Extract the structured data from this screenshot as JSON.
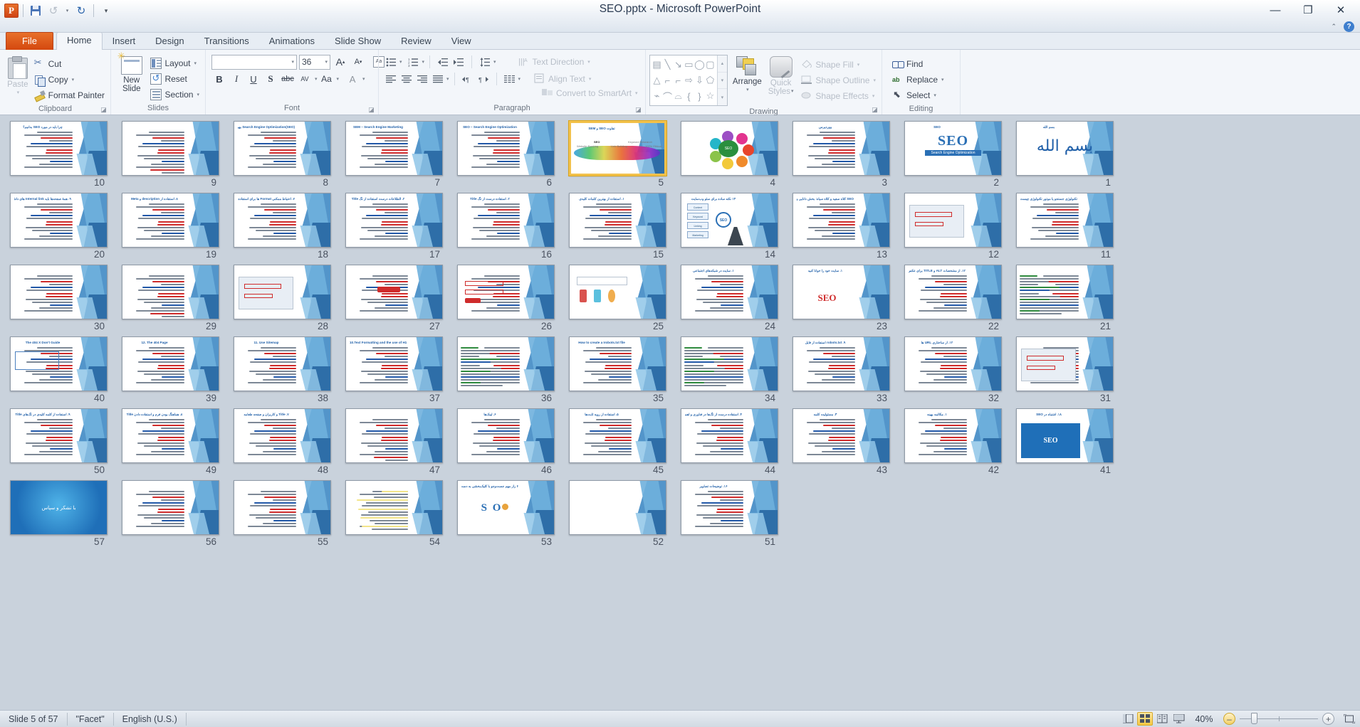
{
  "window": {
    "title": "SEO.pptx  -  Microsoft PowerPoint",
    "minimize": "—",
    "restore": "❐",
    "close": "✕",
    "ribbon_collapse": "⌃",
    "help": "?"
  },
  "qat": {
    "app_letter": "P",
    "save": "save-icon",
    "undo": "↺",
    "undo_caret": "▾",
    "redo": "↻",
    "customize": "▾"
  },
  "tabs": [
    {
      "label": "File",
      "type": "file"
    },
    {
      "label": "Home",
      "type": "active"
    },
    {
      "label": "Insert",
      "type": "normal"
    },
    {
      "label": "Design",
      "type": "normal"
    },
    {
      "label": "Transitions",
      "type": "normal"
    },
    {
      "label": "Animations",
      "type": "normal"
    },
    {
      "label": "Slide Show",
      "type": "normal"
    },
    {
      "label": "Review",
      "type": "normal"
    },
    {
      "label": "View",
      "type": "normal"
    }
  ],
  "ribbon": {
    "groups": [
      {
        "name": "Clipboard",
        "label": "Clipboard",
        "launcher": true
      },
      {
        "name": "Slides",
        "label": "Slides",
        "launcher": false
      },
      {
        "name": "Font",
        "label": "Font",
        "launcher": true
      },
      {
        "name": "Paragraph",
        "label": "Paragraph",
        "launcher": true
      },
      {
        "name": "Drawing",
        "label": "Drawing",
        "launcher": true
      },
      {
        "name": "Editing",
        "label": "Editing",
        "launcher": false
      }
    ],
    "clipboard": {
      "paste": "Paste",
      "paste_caret": "▾",
      "cut": "Cut",
      "copy": "Copy",
      "copy_caret": "▾",
      "format_painter": "Format Painter"
    },
    "slides": {
      "new_slide_line1": "New",
      "new_slide_line2": "Slide",
      "new_slide_caret": "▾",
      "layout": "Layout",
      "layout_caret": "▾",
      "reset": "Reset",
      "section": "Section",
      "section_caret": "▾"
    },
    "font": {
      "font_name": "",
      "font_name_caret": "▾",
      "font_size": "36",
      "font_size_caret": "▾",
      "grow_font": "A",
      "shrink_font": "A",
      "clear_formatting": "Aa",
      "bold": "B",
      "italic": "I",
      "underline": "U",
      "shadow": "S",
      "strikethrough": "abc",
      "char_spacing": "AV",
      "change_case": "Aa",
      "font_color": "A"
    },
    "paragraph": {
      "bullets": "bullets-icon",
      "numbering": "numbering-icon",
      "decrease_indent": "decrease-indent-icon",
      "increase_indent": "increase-indent-icon",
      "line_spacing": "line-spacing-icon",
      "align_left": "align-left-icon",
      "align_center": "align-center-icon",
      "align_right": "align-right-icon",
      "justify": "justify-icon",
      "ltr": "ltr-icon",
      "rtl": "rtl-icon",
      "columns": "columns-icon",
      "text_direction": "Text Direction",
      "align_text": "Align Text",
      "convert_to_smartart": "Convert to SmartArt"
    },
    "drawing": {
      "shapes": [
        "text-box",
        "line",
        "arrow",
        "rectangle",
        "oval",
        "rounded-rectangle",
        "triangle",
        "elbow-connector",
        "elbow-arrow-connector",
        "right-arrow",
        "down-arrow",
        "pentagon",
        "freeform",
        "curve",
        "arc",
        "left-brace",
        "right-brace",
        "star"
      ],
      "scroll_up": "▴",
      "scroll_down": "▾",
      "more": "▾",
      "arrange": "Arrange",
      "arrange_caret": "▾",
      "quick_styles_l1": "Quick",
      "quick_styles_l2": "Styles",
      "quick_styles_caret": "▾",
      "shape_fill": "Shape Fill",
      "shape_outline": "Shape Outline",
      "shape_effects": "Shape Effects",
      "caret": "▾"
    },
    "editing": {
      "find": "Find",
      "replace": "Replace",
      "select": "Select",
      "caret": "▾"
    }
  },
  "status": {
    "slide_counter": "Slide 5 of 57",
    "theme": "\"Facet\"",
    "language": "English (U.S.)",
    "zoom_level": "40%",
    "zoom_out": "–",
    "zoom_in": "+",
    "views": [
      {
        "name": "normal-view",
        "glyph": "normal"
      },
      {
        "name": "slide-sorter-view",
        "glyph": "sorter",
        "active": true
      },
      {
        "name": "reading-view",
        "glyph": "reading"
      },
      {
        "name": "slide-show-view",
        "glyph": "show"
      }
    ],
    "fit_to_window": "fit-slide-to-window-icon"
  },
  "sorter": {
    "selected_slide": 5,
    "rows": [
      [
        {
          "n": 10,
          "title": "چرا باید در مورد SEO بدانیم؟",
          "rtl": true,
          "kind": "text",
          "lines": "t"
        },
        {
          "n": 9,
          "title": "",
          "rtl": true,
          "kind": "text",
          "lines": "dense"
        },
        {
          "n": 8,
          "title": "Search Engine Optimization(SEO) بهینه سازی موتور جستجو",
          "rtl": true,
          "kind": "text",
          "lines": "t"
        },
        {
          "n": 7,
          "title": "SEM – Search Engine Marketing",
          "rtl": false,
          "kind": "text",
          "lines": "t"
        },
        {
          "n": 6,
          "title": "SEO – Search Engine Optimization",
          "rtl": false,
          "kind": "text",
          "lines": "t"
        },
        {
          "n": 5,
          "title": "تفاوت SEO و SEM",
          "rtl": true,
          "kind": "wave",
          "lines": "none"
        },
        {
          "n": 4,
          "title": "",
          "rtl": true,
          "kind": "seo-process",
          "lines": "none"
        },
        {
          "n": 3,
          "title": "ووردپرس",
          "rtl": true,
          "kind": "text",
          "lines": "t"
        },
        {
          "n": 2,
          "title": "SEO",
          "rtl": false,
          "kind": "seo-big",
          "lines": "none"
        },
        {
          "n": 1,
          "title": "بسم الله",
          "rtl": true,
          "kind": "bismillah",
          "lines": "none"
        }
      ],
      [
        {
          "n": 20,
          "title": "۹. همهٔ صفحه‌ها باید Internal link های داشته باشند",
          "rtl": true,
          "kind": "text",
          "lines": "t"
        },
        {
          "n": 19,
          "title": "۸. استفاده از description و Meta",
          "rtl": true,
          "kind": "text",
          "lines": "t"
        },
        {
          "n": 18,
          "title": "۷. احتیاط ممکنی Format ها برای استفاده از تگ Title های",
          "rtl": true,
          "kind": "text",
          "lines": "t"
        },
        {
          "n": 17,
          "title": "۲. الطلاعات درست استفاده از تگ Title",
          "rtl": true,
          "kind": "text",
          "lines": "t"
        },
        {
          "n": 16,
          "title": "۲. استفاده درست از تگ Title",
          "rtl": true,
          "kind": "text",
          "lines": "t"
        },
        {
          "n": 15,
          "title": "۱. استفاده از بهترین کلمات کلیدی",
          "rtl": true,
          "kind": "text",
          "lines": "t"
        },
        {
          "n": 14,
          "title": "۱۴ نکته ساده برای سئو وب‌سایت",
          "rtl": true,
          "kind": "smartart",
          "lines": "none"
        },
        {
          "n": 13,
          "title": "SEO کلاه سفید و کلاه سیاه: بخش دانایی و بخش فانی فنی",
          "rtl": true,
          "kind": "text",
          "lines": "t"
        },
        {
          "n": 12,
          "title": "",
          "rtl": true,
          "kind": "screenshot",
          "lines": "none"
        },
        {
          "n": 11,
          "title": "تکنولوژی جستجو یا موتور تکنولوژی چیست",
          "rtl": true,
          "kind": "text",
          "lines": "t"
        }
      ],
      [
        {
          "n": 30,
          "title": "",
          "rtl": true,
          "kind": "text",
          "lines": "t"
        },
        {
          "n": 29,
          "title": "",
          "rtl": true,
          "kind": "text",
          "lines": "dense"
        },
        {
          "n": 28,
          "title": "",
          "rtl": true,
          "kind": "screenshot",
          "lines": "none"
        },
        {
          "n": 27,
          "title": "",
          "rtl": true,
          "kind": "redbtn",
          "lines": "t"
        },
        {
          "n": 26,
          "title": "",
          "rtl": true,
          "kind": "form",
          "lines": "t"
        },
        {
          "n": 25,
          "title": "",
          "rtl": true,
          "kind": "diagram",
          "lines": "none"
        },
        {
          "n": 24,
          "title": "۱. سایت در شبکه‌های اجتماعی",
          "rtl": true,
          "kind": "text",
          "lines": "t"
        },
        {
          "n": 23,
          "title": "۱. سایت خود را خوانا کنید",
          "rtl": true,
          "kind": "seo-logo",
          "lines": "none"
        },
        {
          "n": 22,
          "title": "۱۲. از مشخصات ALT و TITLE برای عکس‌های img استفاده",
          "rtl": true,
          "kind": "text",
          "lines": "t"
        },
        {
          "n": 21,
          "title": "",
          "rtl": false,
          "kind": "code",
          "lines": "t"
        }
      ],
      [
        {
          "n": 40,
          "title": "The 404 X Don't Guide",
          "rtl": false,
          "kind": "doc",
          "lines": "t"
        },
        {
          "n": 39,
          "title": "12. The 404 Page",
          "rtl": false,
          "kind": "text",
          "lines": "t"
        },
        {
          "n": 38,
          "title": "11. Use Sitemap",
          "rtl": false,
          "kind": "text",
          "lines": "t"
        },
        {
          "n": 37,
          "title": "10.Text Formatting and the use of H1, H2 and H3",
          "rtl": false,
          "kind": "text",
          "lines": "t"
        },
        {
          "n": 36,
          "title": "",
          "rtl": false,
          "kind": "code",
          "lines": "t"
        },
        {
          "n": 35,
          "title": "How to create a Irobots.txt  file",
          "rtl": false,
          "kind": "text",
          "lines": "t"
        },
        {
          "n": 34,
          "title": "",
          "rtl": false,
          "kind": "code",
          "lines": "t"
        },
        {
          "n": 33,
          "title": "۹. robots.txt استفاده از فایل",
          "rtl": true,
          "kind": "text",
          "lines": "t"
        },
        {
          "n": 32,
          "title": "۱۲. از ساختاری URL ها",
          "rtl": true,
          "kind": "text",
          "lines": "t"
        },
        {
          "n": 31,
          "title": "",
          "rtl": true,
          "kind": "screenshot",
          "lines": "t"
        }
      ],
      [
        {
          "n": 50,
          "title": "۹. استفاده از کلمه کلیدی در تگ‌های Title",
          "rtl": true,
          "kind": "text",
          "lines": "t"
        },
        {
          "n": 49,
          "title": "۸. هماهنگ بودن فرم و استفاده دادن Title",
          "rtl": true,
          "kind": "text",
          "lines": "t"
        },
        {
          "n": 48,
          "title": "۷. Title و کاربران و صفحه طعامه",
          "rtl": true,
          "kind": "text",
          "lines": "t"
        },
        {
          "n": 47,
          "title": "",
          "rtl": true,
          "kind": "text",
          "lines": "dense"
        },
        {
          "n": 46,
          "title": "۶. لینک‌ها",
          "rtl": true,
          "kind": "text",
          "lines": "t"
        },
        {
          "n": 45,
          "title": "۵. استفاده از رویه ثابت‌ها",
          "rtl": true,
          "kind": "text",
          "lines": "t"
        },
        {
          "n": 44,
          "title": "۴. استفاده درست از تگ‌ها در فناوری و اهمیت آن",
          "rtl": true,
          "kind": "text",
          "lines": "t"
        },
        {
          "n": 43,
          "title": "۳. مسئولیت کلمه",
          "rtl": true,
          "kind": "text",
          "lines": "t"
        },
        {
          "n": 42,
          "title": "۱. مکالمه بهینه",
          "rtl": true,
          "kind": "text",
          "lines": "t"
        },
        {
          "n": 41,
          "title": "۱۸. اشتباه در SEO",
          "rtl": true,
          "kind": "seo-cloud",
          "lines": "none"
        }
      ],
      [
        {
          "n": 57,
          "title": "با تشکر و سپاس",
          "rtl": true,
          "kind": "thanks",
          "lines": "none"
        },
        {
          "n": 56,
          "title": "",
          "rtl": true,
          "kind": "text",
          "lines": "t"
        },
        {
          "n": 55,
          "title": "",
          "rtl": true,
          "kind": "text",
          "lines": "t"
        },
        {
          "n": 54,
          "title": "",
          "rtl": true,
          "kind": "highlight",
          "lines": "t"
        },
        {
          "n": 53,
          "title": "۶ راز مهم جست‌وجو با کلیک‌بخشی به دست‌افزار مورد نظر",
          "rtl": true,
          "kind": "seo-letters",
          "lines": "none"
        },
        {
          "n": 52,
          "title": "",
          "rtl": true,
          "kind": "blank",
          "lines": "none"
        },
        {
          "n": 51,
          "title": "۱۶. توضیحات تصاویر",
          "rtl": true,
          "kind": "text",
          "lines": "t"
        }
      ]
    ]
  }
}
